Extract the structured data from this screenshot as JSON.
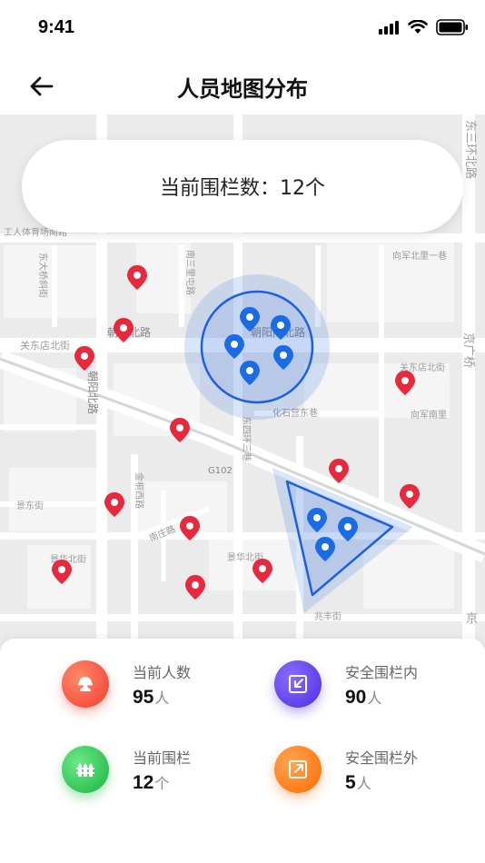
{
  "status_bar": {
    "time": "9:41"
  },
  "nav": {
    "title": "人员地图分布"
  },
  "fence_card": {
    "text": "当前围栏数：12个"
  },
  "map_labels": {
    "dongsanhuan": "东三环北路",
    "jingguang": "京广桥",
    "jing": "京",
    "gongti": "工人体育场南路",
    "dongdaqiao": "东大桥斜街",
    "nandonglu": "南三里屯路",
    "chaoyang_bei": "朝阳北路",
    "chaoyang_n": "朝阳北路",
    "chaoyang_map": "朝阳门北路",
    "guandong": "关东店北街",
    "guandong_r": "关东店北街",
    "xiangjun": "向军北里一巷",
    "xiangjun_nan": "向军南里",
    "huashi": "化石营东巷",
    "g102": "G102",
    "jingdong": "景东街",
    "jinghua": "景华北街",
    "jinghua2": "景华北街",
    "zhaofeng": "兆丰街",
    "dongwu": "东四环三巷",
    "nanzhuang": "南庄路",
    "jinfeng": "金桐西路"
  },
  "stats": [
    {
      "label": "当前人数",
      "value": "95",
      "unit": "人",
      "icon": "worker-helmet-icon",
      "color": "#f4463a"
    },
    {
      "label": "安全围栏内",
      "value": "90",
      "unit": "人",
      "icon": "arrow-in-icon",
      "color": "#5b3de8"
    },
    {
      "label": "当前围栏",
      "value": "12",
      "unit": "个",
      "icon": "fence-icon",
      "color": "#22c44a"
    },
    {
      "label": "安全围栏外",
      "value": "5",
      "unit": "人",
      "icon": "arrow-out-icon",
      "color": "#ff7a00"
    }
  ]
}
